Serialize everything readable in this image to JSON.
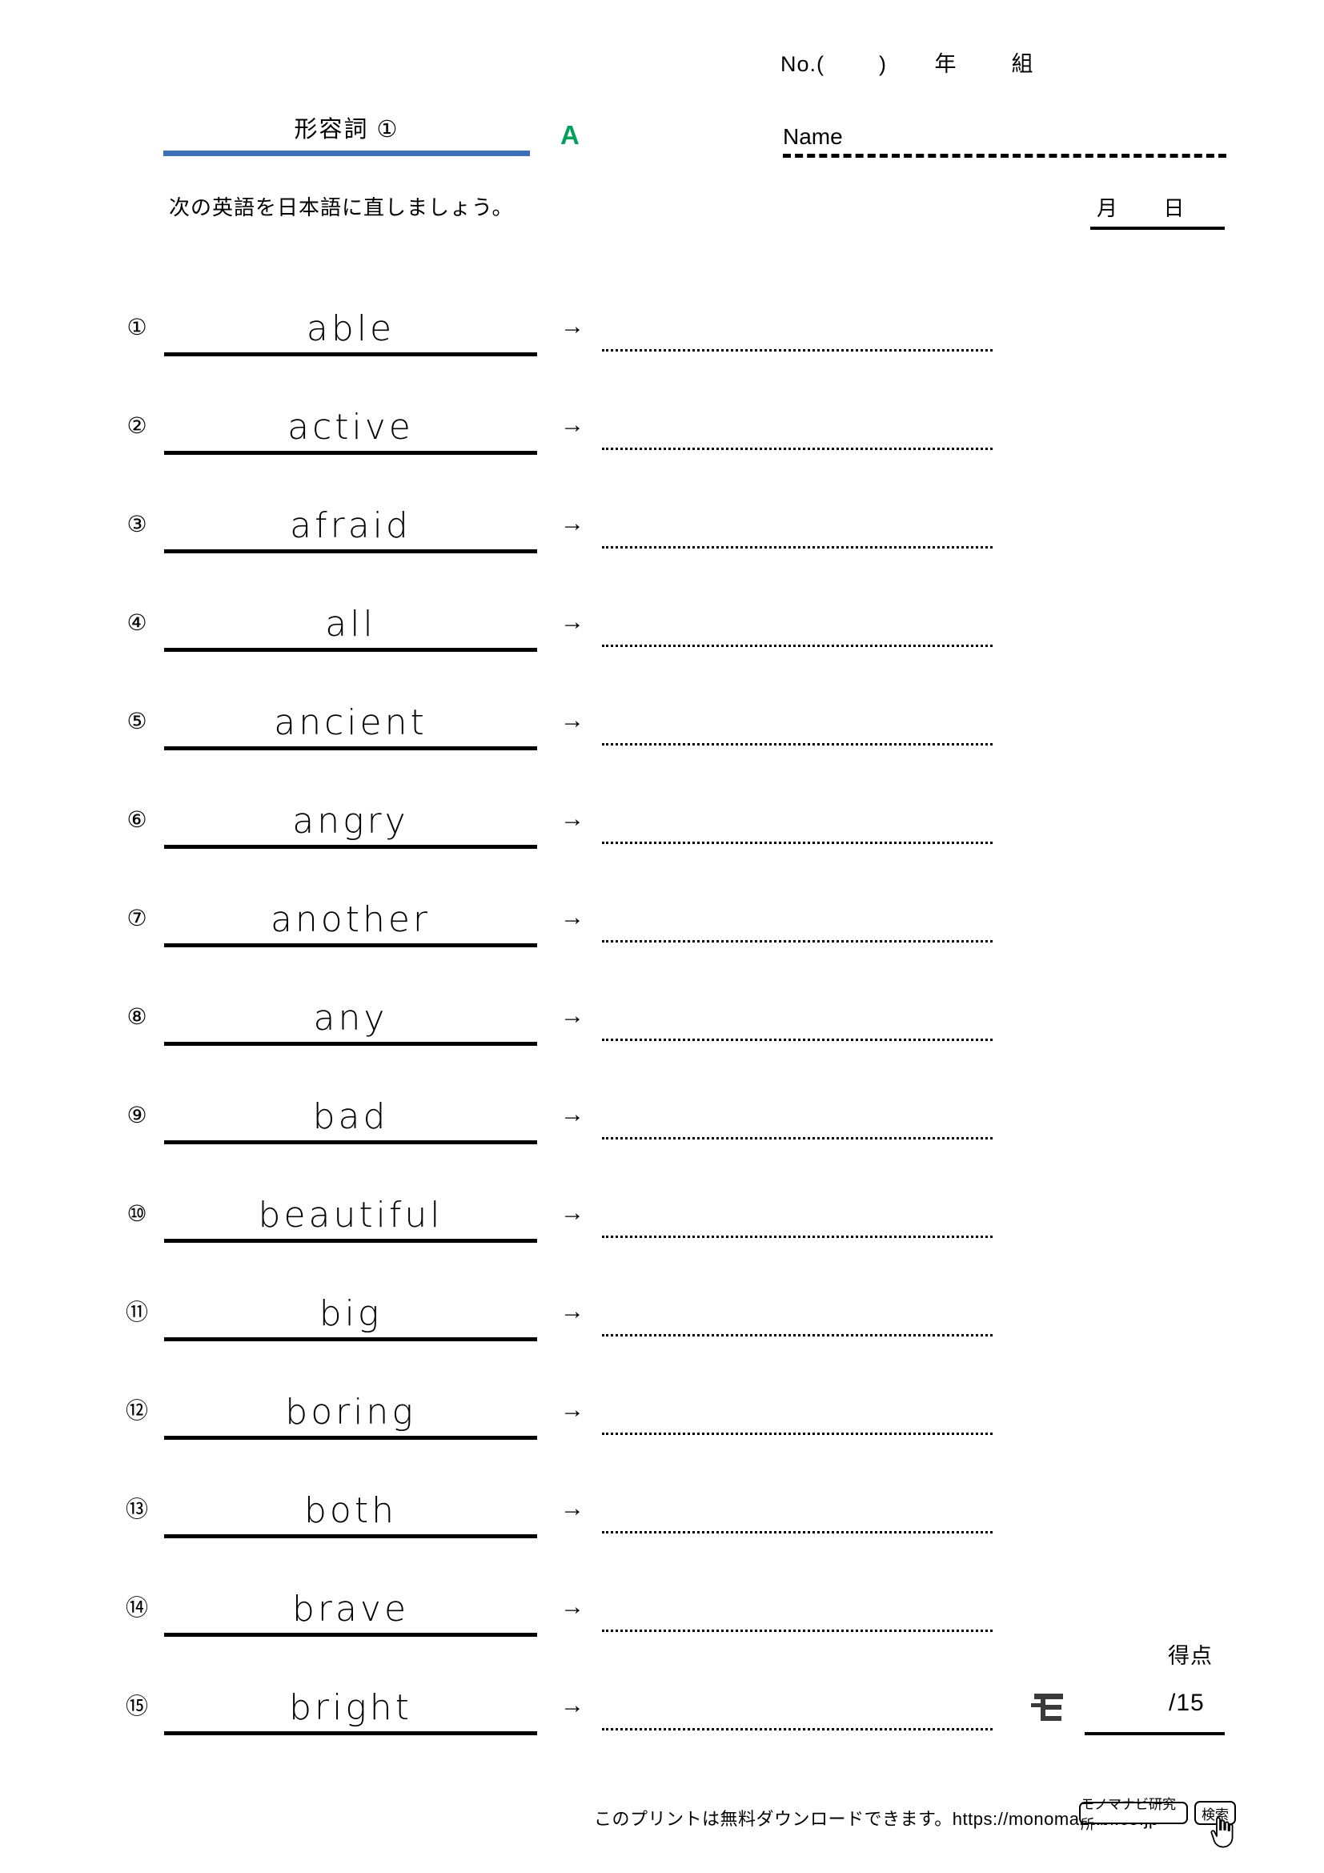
{
  "header": {
    "no_field": "No.(        )       年        組",
    "title": "形容詞 ①",
    "section_mark": "A",
    "name_label": "Name",
    "instruction": "次の英語を日本語に直しましょう。",
    "date_label": "月      日"
  },
  "colors": {
    "title_rule": "#3b6fb8",
    "section_mark": "#00a05a",
    "ink": "#000000",
    "paper": "#ffffff"
  },
  "problems": [
    {
      "num": "①",
      "word": "able",
      "arrow": "→"
    },
    {
      "num": "②",
      "word": "active",
      "arrow": "→"
    },
    {
      "num": "③",
      "word": "afraid",
      "arrow": "→"
    },
    {
      "num": "④",
      "word": "all",
      "arrow": "→"
    },
    {
      "num": "⑤",
      "word": "ancient",
      "arrow": "→"
    },
    {
      "num": "⑥",
      "word": "angry",
      "arrow": "→"
    },
    {
      "num": "⑦",
      "word": "another",
      "arrow": "→"
    },
    {
      "num": "⑧",
      "word": "any",
      "arrow": "→"
    },
    {
      "num": "⑨",
      "word": "bad",
      "arrow": "→"
    },
    {
      "num": "⑩",
      "word": "beautiful",
      "arrow": "→"
    },
    {
      "num": "⑪",
      "word": "big",
      "arrow": "→"
    },
    {
      "num": "⑫",
      "word": "boring",
      "arrow": "→"
    },
    {
      "num": "⑬",
      "word": "both",
      "arrow": "→"
    },
    {
      "num": "⑭",
      "word": "brave",
      "arrow": "→"
    },
    {
      "num": "⑮",
      "word": "bright",
      "arrow": "→"
    }
  ],
  "score": {
    "label": "得点",
    "total": "/15"
  },
  "footer": {
    "notice": "このプリントは無料ダウンロードできます。https://monomanabi.co.jp",
    "search_value": "モノマナビ研究所",
    "search_button": "検索"
  }
}
